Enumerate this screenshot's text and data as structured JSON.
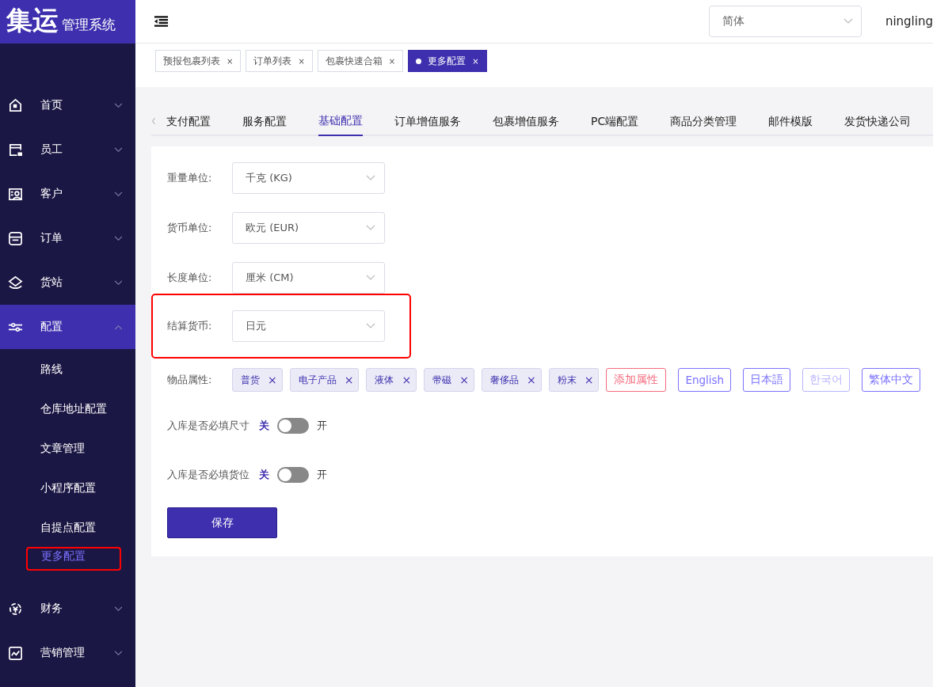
{
  "logo": {
    "main": "集运",
    "sub": "管理系统"
  },
  "sidebar": {
    "items": [
      {
        "label": "首页",
        "selected": false,
        "expanded": false
      },
      {
        "label": "员工",
        "selected": false,
        "expanded": false
      },
      {
        "label": "客户",
        "selected": false,
        "expanded": false
      },
      {
        "label": "订单",
        "selected": false,
        "expanded": false
      },
      {
        "label": "货站",
        "selected": false,
        "expanded": false
      },
      {
        "label": "配置",
        "selected": true,
        "expanded": true,
        "children": [
          {
            "label": "路线",
            "selected": false,
            "highlighted": false
          },
          {
            "label": "仓库地址配置",
            "selected": false,
            "highlighted": false
          },
          {
            "label": "文章管理",
            "selected": false,
            "highlighted": false
          },
          {
            "label": "小程序配置",
            "selected": false,
            "highlighted": false
          },
          {
            "label": "自提点配置",
            "selected": false,
            "highlighted": false
          },
          {
            "label": "更多配置",
            "selected": true,
            "highlighted": true
          }
        ]
      },
      {
        "label": "财务",
        "selected": false,
        "expanded": false
      },
      {
        "label": "营销管理",
        "selected": false,
        "expanded": false
      }
    ]
  },
  "header": {
    "language": "简体",
    "user": "ningling"
  },
  "open_tabs": [
    {
      "label": "预报包裹列表",
      "close": "×",
      "selected": false
    },
    {
      "label": "订单列表",
      "close": "×",
      "selected": false
    },
    {
      "label": "包裹快速合箱",
      "close": "×",
      "selected": false
    },
    {
      "label": "更多配置",
      "close": "×",
      "selected": true
    }
  ],
  "tabs": [
    {
      "label": "支付配置",
      "selected": false
    },
    {
      "label": "服务配置",
      "selected": false
    },
    {
      "label": "基础配置",
      "selected": true
    },
    {
      "label": "订单增值服务",
      "selected": false
    },
    {
      "label": "包裹增值服务",
      "selected": false
    },
    {
      "label": "PC端配置",
      "selected": false
    },
    {
      "label": "商品分类管理",
      "selected": false
    },
    {
      "label": "邮件模版",
      "selected": false
    },
    {
      "label": "发货快递公司",
      "selected": false
    }
  ],
  "form": {
    "selects": [
      {
        "label": "重量单位:",
        "value": "千克 (KG)",
        "highlighted": false
      },
      {
        "label": "货币单位:",
        "value": "欧元 (EUR)",
        "highlighted": false
      },
      {
        "label": "长度单位:",
        "value": "厘米 (CM)",
        "highlighted": false
      },
      {
        "label": "结算货币:",
        "value": "日元",
        "highlighted": true
      }
    ],
    "attributes": {
      "label": "物品属性:",
      "items": [
        {
          "kind": "tag",
          "text": "普货",
          "close": "×"
        },
        {
          "kind": "tag",
          "text": "电子产品",
          "close": "×"
        },
        {
          "kind": "tag",
          "text": "液体",
          "close": "×"
        },
        {
          "kind": "tag",
          "text": "带磁",
          "close": "×"
        },
        {
          "kind": "tag",
          "text": "奢侈品",
          "close": "×"
        },
        {
          "kind": "tag",
          "text": "粉末",
          "close": "×"
        },
        {
          "kind": "add",
          "text": "添加属性"
        },
        {
          "kind": "lang",
          "text": "English",
          "disabled": false
        },
        {
          "kind": "lang",
          "text": "日本語",
          "disabled": false
        },
        {
          "kind": "lang",
          "text": "한국어",
          "disabled": true
        },
        {
          "kind": "lang",
          "text": "繁体中文",
          "disabled": false
        }
      ]
    },
    "switches": [
      {
        "label": "入库是否必填尺寸",
        "off": "关",
        "on_label": "开",
        "on": false
      },
      {
        "label": "入库是否必填货位",
        "off": "关",
        "on_label": "开",
        "on": false
      }
    ],
    "save": "保存"
  }
}
